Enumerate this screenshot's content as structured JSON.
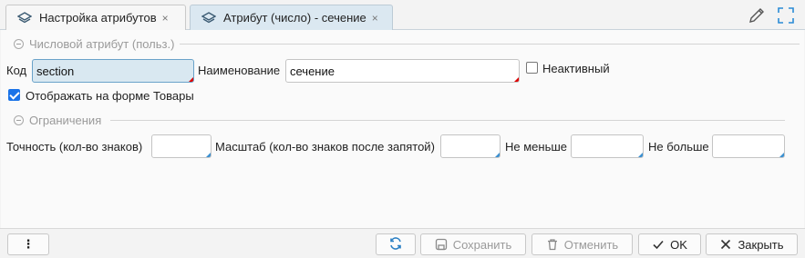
{
  "tabs": [
    {
      "label": "Настройка атрибутов",
      "close": "×"
    },
    {
      "label": "Атрибут (число) - сечение",
      "close": "×"
    }
  ],
  "section_numeric": {
    "title": "Числовой атрибут (польз.)"
  },
  "code": {
    "label": "Код",
    "value": "section"
  },
  "name": {
    "label": "Наименование",
    "value": "сечение"
  },
  "inactive": {
    "label": "Неактивный",
    "checked": false
  },
  "show_on_form": {
    "label": "Отображать на форме Товары",
    "checked": true
  },
  "section_limits": {
    "title": "Ограничения"
  },
  "precision": {
    "label": "Точность (кол-во знаков)",
    "value": ""
  },
  "scale": {
    "label": "Масштаб (кол-во знаков после запятой)",
    "value": ""
  },
  "min": {
    "label": "Не меньше",
    "value": ""
  },
  "max": {
    "label": "Не больше",
    "value": ""
  },
  "buttons": {
    "more": "⋮",
    "save": "Сохранить",
    "cancel": "Отменить",
    "ok": "OK",
    "close": "Закрыть"
  },
  "colors": {
    "accent": "#1a73e8",
    "active_tab": "#dbe8f1",
    "focused_input": "#d9e8f1"
  }
}
